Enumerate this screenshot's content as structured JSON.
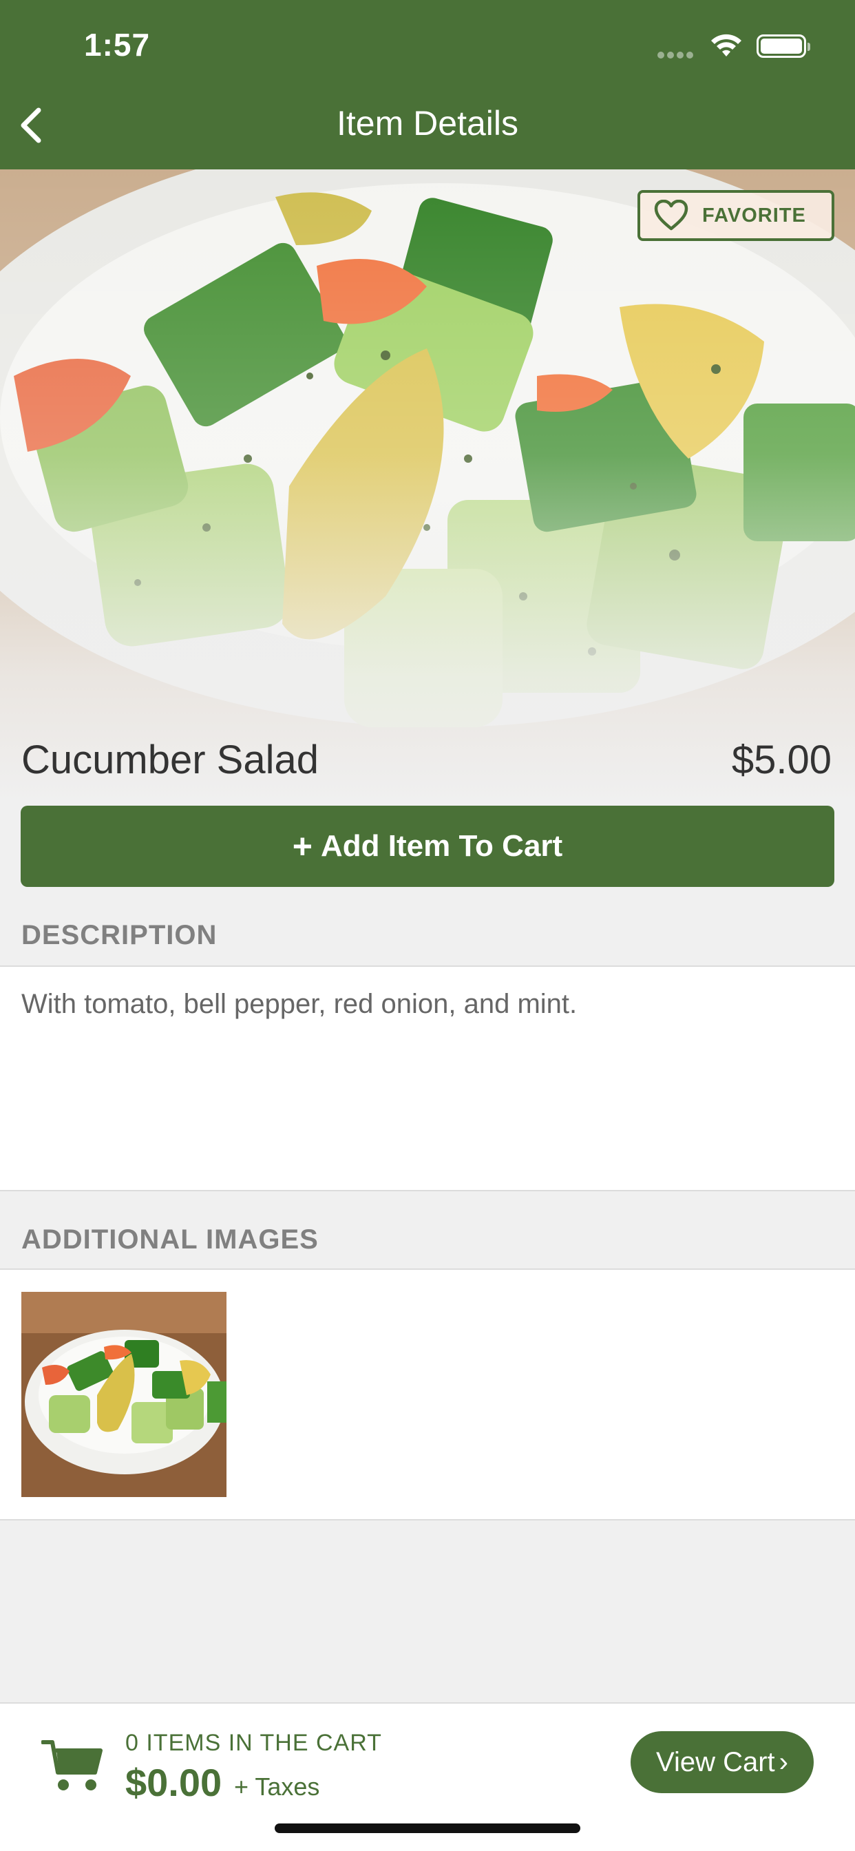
{
  "status_bar": {
    "time": "1:57"
  },
  "nav": {
    "title": "Item Details",
    "back_icon": "chevron-left-icon"
  },
  "favorite": {
    "label": "FAVORITE",
    "icon": "heart-outline-icon"
  },
  "item": {
    "name": "Cucumber Salad",
    "price": "$5.00"
  },
  "add_to_cart": {
    "icon": "+",
    "label": "Add Item To Cart"
  },
  "description": {
    "heading": "DESCRIPTION",
    "text": "With tomato, bell pepper, red onion, and mint."
  },
  "additional_images": {
    "heading": "ADDITIONAL IMAGES"
  },
  "cart_bar": {
    "icon": "shopping-cart-icon",
    "count_text": "0 ITEMS IN THE CART",
    "total": "$0.00",
    "taxes": "+ Taxes",
    "view_cart_label": "View Cart",
    "view_cart_chevron": "›"
  },
  "colors": {
    "brand_green": "#4a7137",
    "background": "#f0f0f0"
  }
}
